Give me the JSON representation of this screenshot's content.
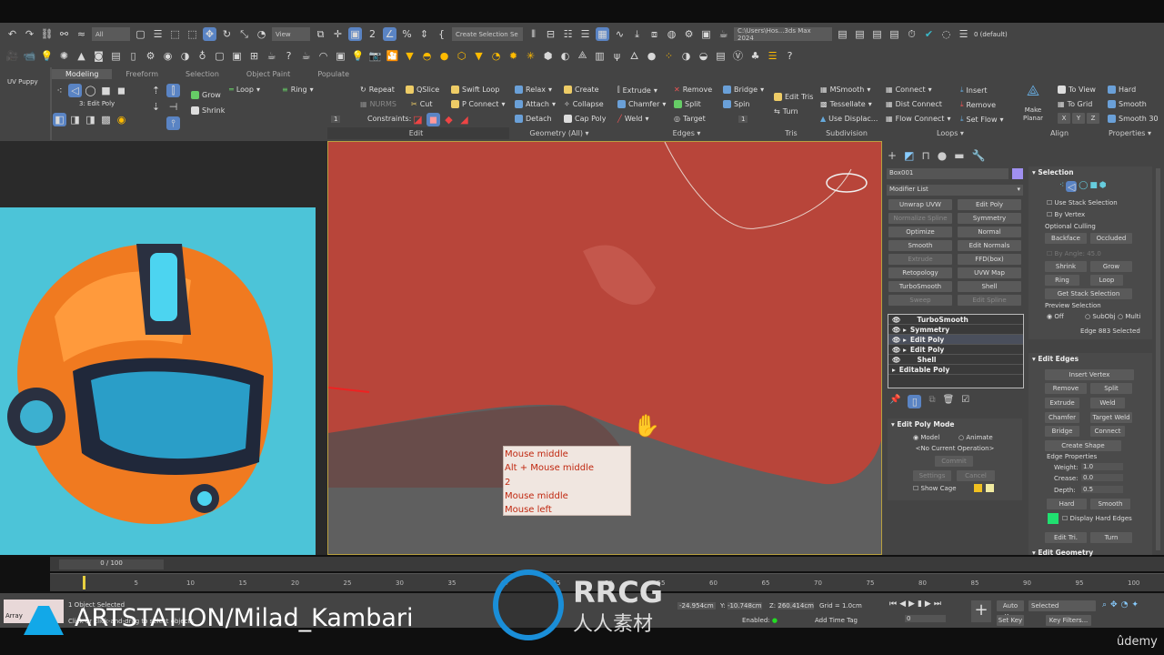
{
  "toolbar": {
    "selection_filter": "All",
    "ref_coord": "View",
    "named_selection": "Create Selection Se",
    "project_path": "C:\\Users\\Hos...3ds Max 2024",
    "layer": "0 (default)"
  },
  "left_label": "UV Puppy",
  "ribbon": {
    "tabs": [
      "Modeling",
      "Freeform",
      "Selection",
      "Object Paint",
      "Populate"
    ],
    "stack_level": "3: Edit Poly",
    "modify_selection": {
      "grow": "Grow",
      "shrink": "Shrink",
      "loop": "Loop",
      "ring": "Ring"
    },
    "edit": {
      "repeat": "Repeat",
      "qslice": "QSlice",
      "swift_loop": "Swift Loop",
      "nurms": "NURMS",
      "cut": "Cut",
      "p_connect": "P Connect",
      "constraints": "Constraints:",
      "spinner": "1",
      "label": "Edit"
    },
    "geometry": {
      "relax": "Relax",
      "create": "Create",
      "attach": "Attach",
      "collapse": "Collapse",
      "detach": "Detach",
      "cap_poly": "Cap Poly",
      "label": "Geometry (All)"
    },
    "edges": {
      "extrude": "Extrude",
      "remove": "Remove",
      "bridge": "Bridge",
      "chamfer": "Chamfer",
      "split": "Split",
      "spin": "Spin",
      "weld": "Weld",
      "target": "Target",
      "spinner": "1",
      "label": "Edges"
    },
    "tris": {
      "edit_tris": "Edit Tris",
      "turn": "Turn",
      "label": "Tris"
    },
    "subdivision": {
      "msmooth": "MSmooth",
      "tessellate": "Tessellate",
      "use_displac": "Use Displac...",
      "label": "Subdivision"
    },
    "loops": {
      "connect": "Connect",
      "dist_connect": "Dist Connect",
      "flow_connect": "Flow Connect",
      "insert": "Insert",
      "remove": "Remove",
      "set_flow": "Set Flow",
      "label": "Loops"
    },
    "align": {
      "make_planar": "Make Planar",
      "to_view": "To View",
      "to_grid": "To Grid",
      "x": "X",
      "y": "Y",
      "z": "Z",
      "label": "Align"
    },
    "properties": {
      "hard": "Hard",
      "smooth": "Smooth",
      "smooth30": "Smooth 30",
      "label": "Properties"
    }
  },
  "viewport": {
    "tooltip": [
      "Mouse middle",
      "Alt + Mouse middle",
      "2",
      "Mouse middle",
      "Mouse left"
    ],
    "mesh_color": "#b8453a"
  },
  "command_panel": {
    "object_name": "Box001",
    "object_color": "#a090f0",
    "modifier_list": "Modifier List",
    "modifier_buttons": [
      {
        "label": "Unwrap UVW",
        "enabled": true
      },
      {
        "label": "Edit Poly",
        "enabled": true
      },
      {
        "label": "Normalize Spline",
        "enabled": false
      },
      {
        "label": "Symmetry",
        "enabled": true
      },
      {
        "label": "Optimize",
        "enabled": true
      },
      {
        "label": "Normal",
        "enabled": true
      },
      {
        "label": "Smooth",
        "enabled": true
      },
      {
        "label": "Edit Normals",
        "enabled": true
      },
      {
        "label": "Extrude",
        "enabled": false
      },
      {
        "label": "FFD(box)",
        "enabled": true
      },
      {
        "label": "Retopology",
        "enabled": true
      },
      {
        "label": "UVW Map",
        "enabled": true
      },
      {
        "label": "TurboSmooth",
        "enabled": true
      },
      {
        "label": "Shell",
        "enabled": true
      },
      {
        "label": "Sweep",
        "enabled": false
      },
      {
        "label": "Edit Spline",
        "enabled": false
      }
    ],
    "stack": [
      "TurboSmooth",
      "Symmetry",
      "Edit Poly",
      "Edit Poly",
      "Shell",
      "Editable Poly"
    ],
    "edit_poly_mode": {
      "title": "Edit Poly Mode",
      "model": "Model",
      "animate": "Animate",
      "operation": "<No Current Operation>",
      "commit": "Commit",
      "settings": "Settings",
      "cancel": "Cancel",
      "show_cage": "Show Cage"
    },
    "selection": {
      "title": "Selection",
      "use_stack": "Use Stack Selection",
      "by_vertex": "By Vertex",
      "culling": "Optional Culling",
      "backface": "Backface",
      "occluded": "Occluded",
      "by_angle": "By Angle:",
      "angle": "45.0",
      "shrink": "Shrink",
      "grow": "Grow",
      "ring": "Ring",
      "loop": "Loop",
      "get_stack": "Get Stack Selection",
      "preview": "Preview Selection",
      "off": "Off",
      "subobj": "SubObj",
      "multi": "Multi",
      "status": "Edge 883 Selected"
    },
    "edit_edges": {
      "title": "Edit Edges",
      "insert_vertex": "Insert Vertex",
      "remove": "Remove",
      "split": "Split",
      "extrude": "Extrude",
      "weld": "Weld",
      "chamfer": "Chamfer",
      "target_weld": "Target Weld",
      "bridge": "Bridge",
      "connect": "Connect",
      "create_shape": "Create Shape",
      "edge_props": "Edge Properties",
      "weight_l": "Weight:",
      "weight": "1.0",
      "crease_l": "Crease:",
      "crease": "0.0",
      "depth_l": "Depth:",
      "depth": "0.5",
      "hard": "Hard",
      "smooth": "Smooth",
      "display_hard": "Display Hard Edges",
      "edit_tri": "Edit Tri.",
      "turn": "Turn",
      "hard_color": "#20e070"
    },
    "edit_geometry": "Edit Geometry"
  },
  "timeline": {
    "frame": "0 / 100",
    "ticks": [
      "5",
      "10",
      "15",
      "20",
      "25",
      "30",
      "35",
      "40",
      "45",
      "50",
      "55",
      "60",
      "65",
      "70",
      "75",
      "80",
      "85",
      "90",
      "95",
      "100"
    ]
  },
  "status": {
    "selected": "1 Object Selected",
    "prompt": "Click or click-and-drag to select objects",
    "script": "Array",
    "x": "-24.954cm",
    "y": "-10.748cm",
    "z": "260.414cm",
    "grid": "Grid = 1.0cm",
    "enabled": "Enabled:",
    "add_time_tag": "Add Time Tag",
    "auto_key": "Auto Key",
    "set_key": "Set Key",
    "key_mode": "Selected",
    "key_filters": "Key Filters...",
    "frame_field": "0"
  },
  "watermarks": {
    "artstation": "ARTSTATION/Milad_Kambari",
    "rrcg": "RRCG",
    "rrcg_cn": "人人素材",
    "udemy": "ûdemy"
  }
}
